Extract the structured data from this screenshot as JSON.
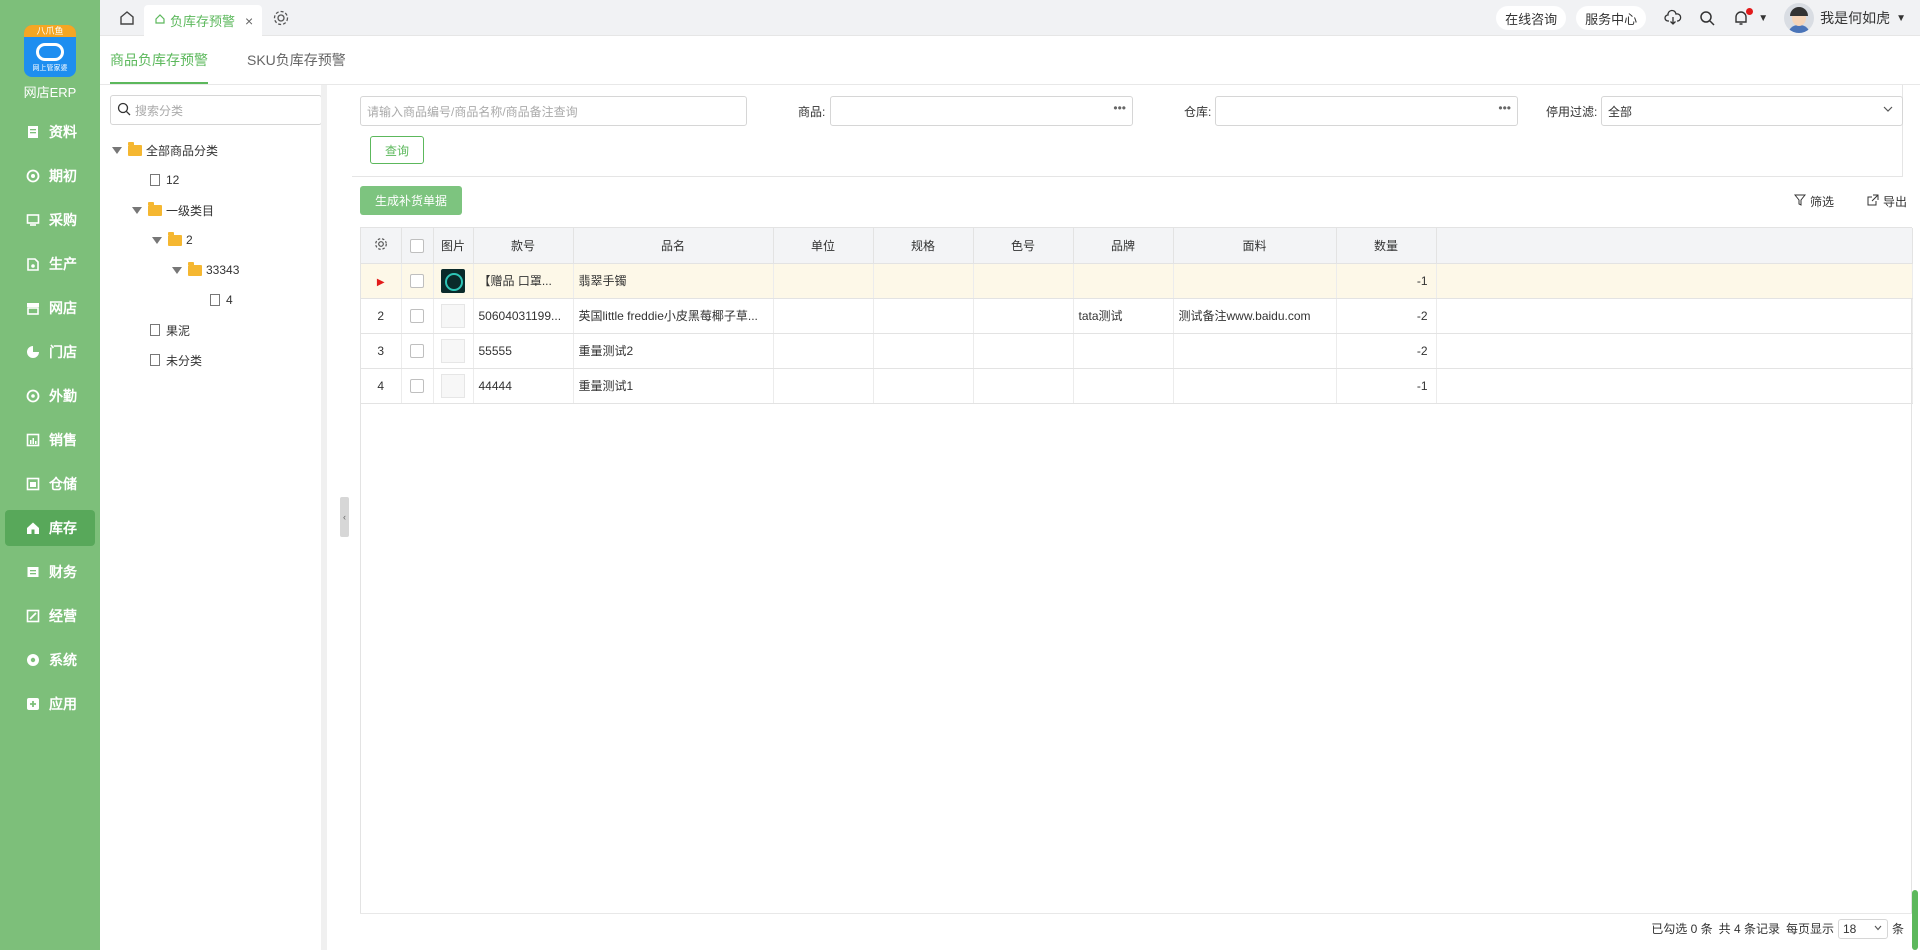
{
  "brand": {
    "ribbon": "八爪鱼",
    "logo_sub": "网上管家婆",
    "name": "网店ERP"
  },
  "nav": [
    {
      "label": "资料",
      "icon": "document-icon"
    },
    {
      "label": "期初",
      "icon": "target-icon"
    },
    {
      "label": "采购",
      "icon": "cart-icon"
    },
    {
      "label": "生产",
      "icon": "factory-icon"
    },
    {
      "label": "网店",
      "icon": "store-icon"
    },
    {
      "label": "门店",
      "icon": "pie-icon"
    },
    {
      "label": "外勤",
      "icon": "compass-icon"
    },
    {
      "label": "销售",
      "icon": "chart-icon"
    },
    {
      "label": "仓储",
      "icon": "warehouse-icon"
    },
    {
      "label": "库存",
      "icon": "home-icon",
      "active": true
    },
    {
      "label": "财务",
      "icon": "wallet-icon"
    },
    {
      "label": "经营",
      "icon": "edit-icon"
    },
    {
      "label": "系统",
      "icon": "gear-icon"
    },
    {
      "label": "应用",
      "icon": "plus-icon"
    }
  ],
  "topbar": {
    "tab_label": "负库存预警",
    "online_consult": "在线咨询",
    "service_center": "服务中心",
    "username": "我是何如虎"
  },
  "subtabs": [
    "商品负库存预警",
    "SKU负库存预警"
  ],
  "tree": {
    "search_placeholder": "搜索分类",
    "nodes": [
      {
        "label": "全部商品分类"
      },
      {
        "label": "12"
      },
      {
        "label": "一级类目"
      },
      {
        "label": "2"
      },
      {
        "label": "33343"
      },
      {
        "label": "4"
      },
      {
        "label": "果泥"
      },
      {
        "label": "未分类"
      }
    ]
  },
  "filters": {
    "search_placeholder": "请输入商品编号/商品名称/商品备注查询",
    "product_label": "商品:",
    "warehouse_label": "仓库:",
    "disabled_label": "停用过滤:",
    "disabled_value": "全部",
    "query_button": "查询"
  },
  "actions": {
    "generate_button": "生成补货单据",
    "filter_label": "筛选",
    "export_label": "导出"
  },
  "table": {
    "headers": [
      "图片",
      "款号",
      "品名",
      "单位",
      "规格",
      "色号",
      "品牌",
      "面料",
      "数量"
    ],
    "rows": [
      {
        "index": "",
        "code": "【赠品 口罩...",
        "name": "翡翠手镯",
        "unit": "",
        "spec": "",
        "color": "",
        "brand": "",
        "fabric": "",
        "qty": "-1"
      },
      {
        "index": "2",
        "code": "50604031199...",
        "name": "英国little freddie小皮黑莓椰子草...",
        "unit": "",
        "spec": "",
        "color": "",
        "brand": "tata测试",
        "fabric": "测试备注www.baidu.com",
        "qty": "-2"
      },
      {
        "index": "3",
        "code": "55555",
        "name": "重量测试2",
        "unit": "",
        "spec": "",
        "color": "",
        "brand": "",
        "fabric": "",
        "qty": "-2"
      },
      {
        "index": "4",
        "code": "44444",
        "name": "重量测试1",
        "unit": "",
        "spec": "",
        "color": "",
        "brand": "",
        "fabric": "",
        "qty": "-1"
      }
    ]
  },
  "footer": {
    "selected": "已勾选 0 条",
    "total": "共 4 条记录",
    "per_page_label": "每页显示",
    "page_size": "18",
    "unit": "条"
  },
  "colors": {
    "sidebar": "#7dbf7a",
    "accent": "#5cb85c",
    "active_nav": "#58a85a"
  }
}
